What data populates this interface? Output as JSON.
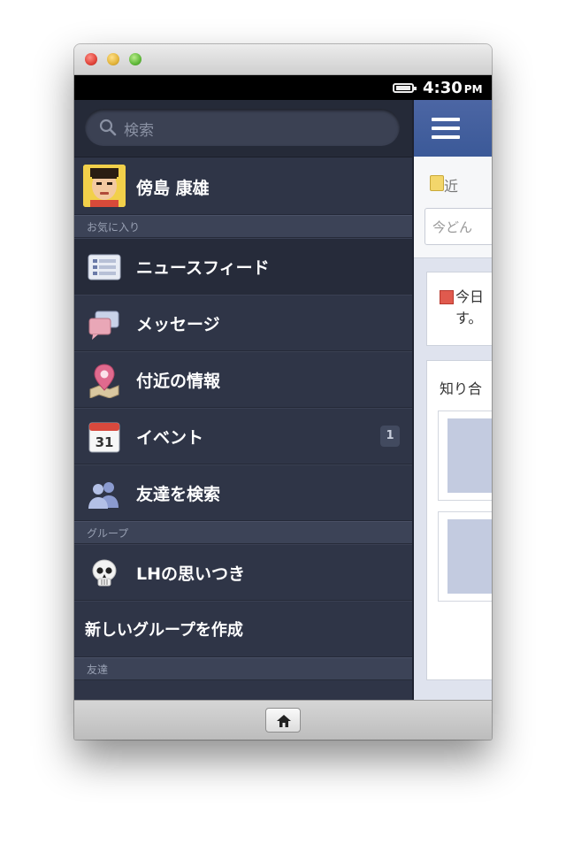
{
  "status_bar": {
    "time": "4:30",
    "ampm": "PM"
  },
  "search": {
    "placeholder": "検索"
  },
  "profile": {
    "name": "傍島 康雄"
  },
  "sections": {
    "favorites": "お気に入り",
    "groups": "グループ",
    "friends": "友達"
  },
  "menu": {
    "news_feed": "ニュースフィード",
    "messages": "メッセージ",
    "nearby": "付近の情報",
    "events": "イベント",
    "events_badge": "1",
    "find_friends": "友達を検索",
    "group_lh": "LHの思いつき",
    "create_group": "新しいグループを作成"
  },
  "icons": {
    "calendar_day": "31"
  },
  "content": {
    "nearby_label": "近",
    "status_placeholder": "今どん",
    "card_text_line1": "今日",
    "card_text_line2": "す。",
    "people_title": "知り合"
  },
  "colors": {
    "sidebar_bg": "#2f3547",
    "section_bg": "#3c4357",
    "fb_blue": "#3b5998"
  }
}
